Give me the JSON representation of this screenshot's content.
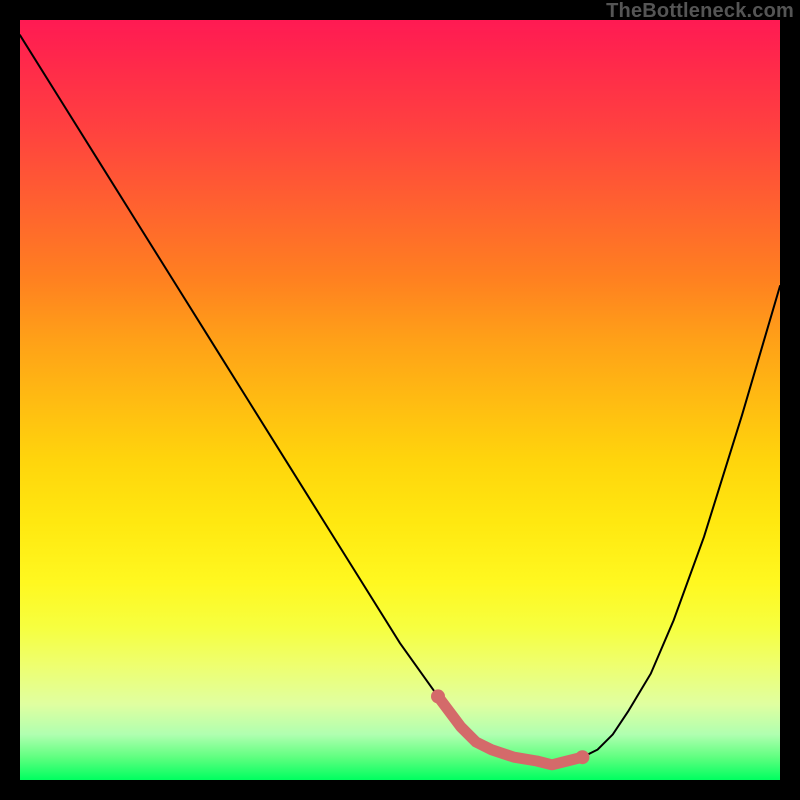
{
  "watermark": "TheBottleneck.com",
  "colors": {
    "curve": "#000000",
    "marker": "#d46a6a",
    "background_top": "#ff1a53",
    "background_bottom": "#00ff60"
  },
  "chart_data": {
    "type": "line",
    "title": "",
    "xlabel": "",
    "ylabel": "",
    "xlim": [
      0,
      100
    ],
    "ylim": [
      0,
      100
    ],
    "main_curve": {
      "name": "bottleneck-curve",
      "x": [
        0,
        5,
        10,
        15,
        20,
        25,
        30,
        35,
        40,
        45,
        50,
        55,
        58,
        60,
        62,
        65,
        68,
        70,
        72,
        74,
        76,
        78,
        80,
        83,
        86,
        90,
        95,
        100
      ],
      "y": [
        98,
        90,
        82,
        74,
        66,
        58,
        50,
        42,
        34,
        26,
        18,
        11,
        7,
        5,
        4,
        3,
        2.5,
        2,
        2.5,
        3,
        4,
        6,
        9,
        14,
        21,
        32,
        48,
        65
      ]
    },
    "highlight_segment": {
      "name": "optimal-range-highlight",
      "x": [
        55,
        58,
        60,
        62,
        65,
        68,
        70,
        72,
        74
      ],
      "y": [
        11,
        7,
        5,
        4,
        3,
        2.5,
        2,
        2.5,
        3
      ]
    },
    "markers": [
      {
        "x": 55,
        "y": 11
      },
      {
        "x": 74,
        "y": 3
      }
    ]
  }
}
